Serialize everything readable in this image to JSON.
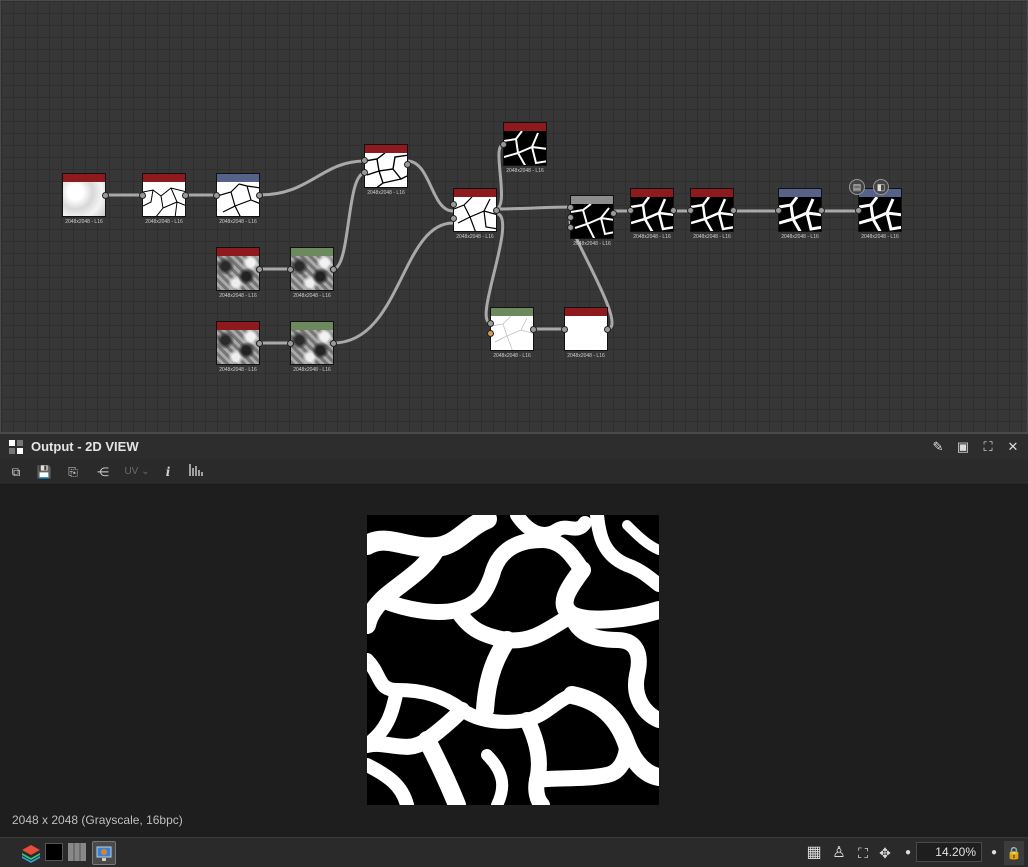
{
  "graph": {
    "nodes": [
      {
        "id": "n1",
        "header": "red",
        "thumb": "blur",
        "caption": "2048x2048 - L16"
      },
      {
        "id": "n2",
        "header": "red",
        "thumb": "cells-w",
        "caption": "2048x2048 - L16"
      },
      {
        "id": "n3",
        "header": "blue",
        "thumb": "cells-w",
        "caption": "2048x2048 - L16"
      },
      {
        "id": "n4",
        "header": "red",
        "thumb": "noise",
        "caption": "2048x2048 - L16"
      },
      {
        "id": "n5",
        "header": "green",
        "thumb": "noise",
        "caption": "2048x2048 - L16"
      },
      {
        "id": "n6",
        "header": "red",
        "thumb": "noise",
        "caption": "2048x2048 - L16"
      },
      {
        "id": "n7",
        "header": "green",
        "thumb": "noise",
        "caption": "2048x2048 - L16"
      },
      {
        "id": "n8",
        "header": "red",
        "thumb": "cells-w",
        "caption": "2048x2048 - L16"
      },
      {
        "id": "n9",
        "header": "red",
        "thumb": "cells-w",
        "caption": "2048x2048 - L16"
      },
      {
        "id": "n10",
        "header": "red",
        "thumb": "cells-b",
        "caption": "2048x2048 - L16"
      },
      {
        "id": "n11",
        "header": "gray",
        "thumb": "cells-b",
        "caption": "2048x2048 - L16"
      },
      {
        "id": "n12",
        "header": "green",
        "thumb": "white",
        "caption": "2048x2048 - L16"
      },
      {
        "id": "n13",
        "header": "red",
        "thumb": "white",
        "caption": "2048x2048 - L16"
      },
      {
        "id": "n14",
        "header": "red",
        "thumb": "cells-b",
        "caption": "2048x2048 - L16"
      },
      {
        "id": "n15",
        "header": "red",
        "thumb": "cells-b",
        "caption": "2048x2048 - L16"
      },
      {
        "id": "n16",
        "header": "blue",
        "thumb": "cells-b",
        "caption": "2048x2048 - L16"
      },
      {
        "id": "n17",
        "header": "blue",
        "thumb": "cells-b",
        "caption": "2048x2048 - L16"
      }
    ]
  },
  "panel": {
    "title": "Output - 2D VIEW",
    "pin_icon": "pin-icon",
    "restore_icon": "restore-icon",
    "maximize_icon": "maximize-icon",
    "close_icon": "close-icon"
  },
  "toolbar": {
    "uv_label": "UV",
    "info_label": "i"
  },
  "viewport": {
    "status": "2048 x 2048 (Grayscale, 16bpc)"
  },
  "bottom": {
    "zoom": "14.20%"
  },
  "colors": {
    "header_red": "#8e1a1e",
    "header_blue": "#56628a",
    "header_green": "#6c8a5e",
    "header_gray": "#8d8d8d"
  }
}
